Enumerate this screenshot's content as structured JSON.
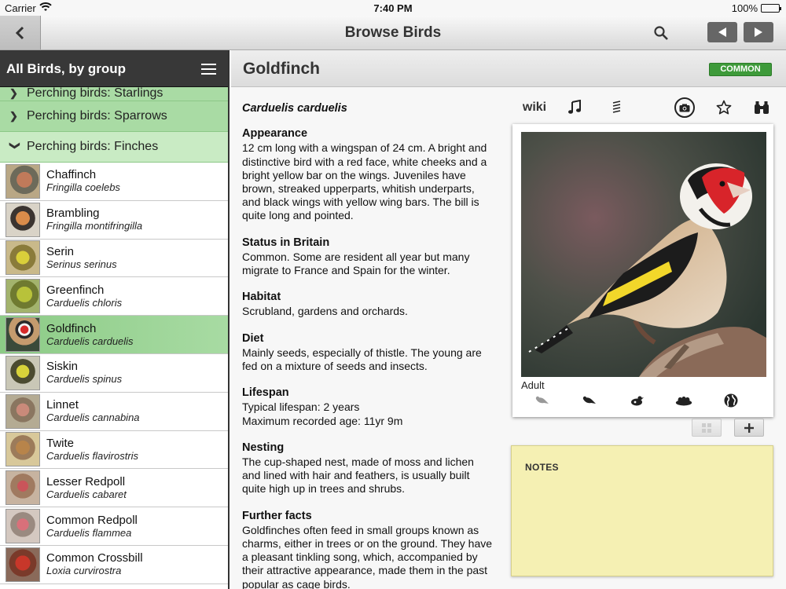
{
  "status_bar": {
    "carrier": "Carrier",
    "time": "7:40 PM",
    "battery": "100%",
    "battery_level": 1.0
  },
  "nav": {
    "title": "Browse Birds"
  },
  "sidebar": {
    "title": "All Birds, by group",
    "groups": [
      {
        "label": "Perching birds: Starlings",
        "expanded": false
      },
      {
        "label": "Perching birds: Sparrows",
        "expanded": false
      },
      {
        "label": "Perching birds: Finches",
        "expanded": true
      }
    ],
    "birds": [
      {
        "name": "Chaffinch",
        "scientific": "Fringilla coelebs",
        "selected": false
      },
      {
        "name": "Brambling",
        "scientific": "Fringilla montifringilla",
        "selected": false
      },
      {
        "name": "Serin",
        "scientific": "Serinus serinus",
        "selected": false
      },
      {
        "name": "Greenfinch",
        "scientific": "Carduelis chloris",
        "selected": false
      },
      {
        "name": "Goldfinch",
        "scientific": "Carduelis carduelis",
        "selected": true
      },
      {
        "name": "Siskin",
        "scientific": "Carduelis spinus",
        "selected": false
      },
      {
        "name": "Linnet",
        "scientific": "Carduelis cannabina",
        "selected": false
      },
      {
        "name": "Twite",
        "scientific": "Carduelis flavirostris",
        "selected": false
      },
      {
        "name": "Lesser Redpoll",
        "scientific": "Carduelis cabaret",
        "selected": false
      },
      {
        "name": "Common Redpoll",
        "scientific": "Carduelis flammea",
        "selected": false
      },
      {
        "name": "Common Crossbill",
        "scientific": "Loxia curvirostra",
        "selected": false
      }
    ]
  },
  "detail": {
    "title": "Goldfinch",
    "status_badge": "COMMON",
    "scientific_name": "Carduelis carduelis",
    "sections": [
      {
        "heading": "Appearance",
        "text": "12 cm long with a wingspan of 24 cm. A bright and distinctive bird with a red face, white cheeks and a bright yellow bar on the wings. Juveniles have brown, streaked upperparts, whitish underparts, and black wings with yellow wing bars. The bill is quite long and pointed."
      },
      {
        "heading": "Status in Britain",
        "text": "Common. Some are resident all year but many migrate to France and Spain for the winter."
      },
      {
        "heading": "Habitat",
        "text": "Scrubland, gardens and orchards."
      },
      {
        "heading": "Diet",
        "text": "Mainly seeds, especially of thistle. The young are fed on a mixture of seeds and insects."
      },
      {
        "heading": "Lifespan",
        "text": "Typical lifespan: 2 years\nMaximum recorded age: 11yr 9m"
      },
      {
        "heading": "Nesting",
        "text": "The cup-shaped nest, made of moss and lichen and lined with hair and feathers, is usually built quite high up in trees and shrubs."
      },
      {
        "heading": "Further facts",
        "text": "Goldfinches often feed in small groups known as charms, either in trees or on the ground. They have a pleasant tinkling song, which, accompanied by their attractive appearance, made them in the past popular as cage birds."
      }
    ],
    "toolbar": {
      "wiki_label": "wiki",
      "icons": [
        "music-note-icon",
        "list-icon",
        "camera-icon",
        "star-icon",
        "binoculars-icon"
      ]
    },
    "photo": {
      "caption": "Adult",
      "strip_icons": [
        "juvenile-bird-icon",
        "adult-bird-icon",
        "bird-in-flight-icon",
        "nest-icon",
        "globe-icon"
      ]
    },
    "notes_label": "NOTES"
  },
  "colors": {
    "group_row": "#a9dba4",
    "selected_row": "#8ccb86",
    "sidebar_header": "#383838",
    "badge": "#3e9a3a",
    "notes": "#f5f0b3"
  }
}
